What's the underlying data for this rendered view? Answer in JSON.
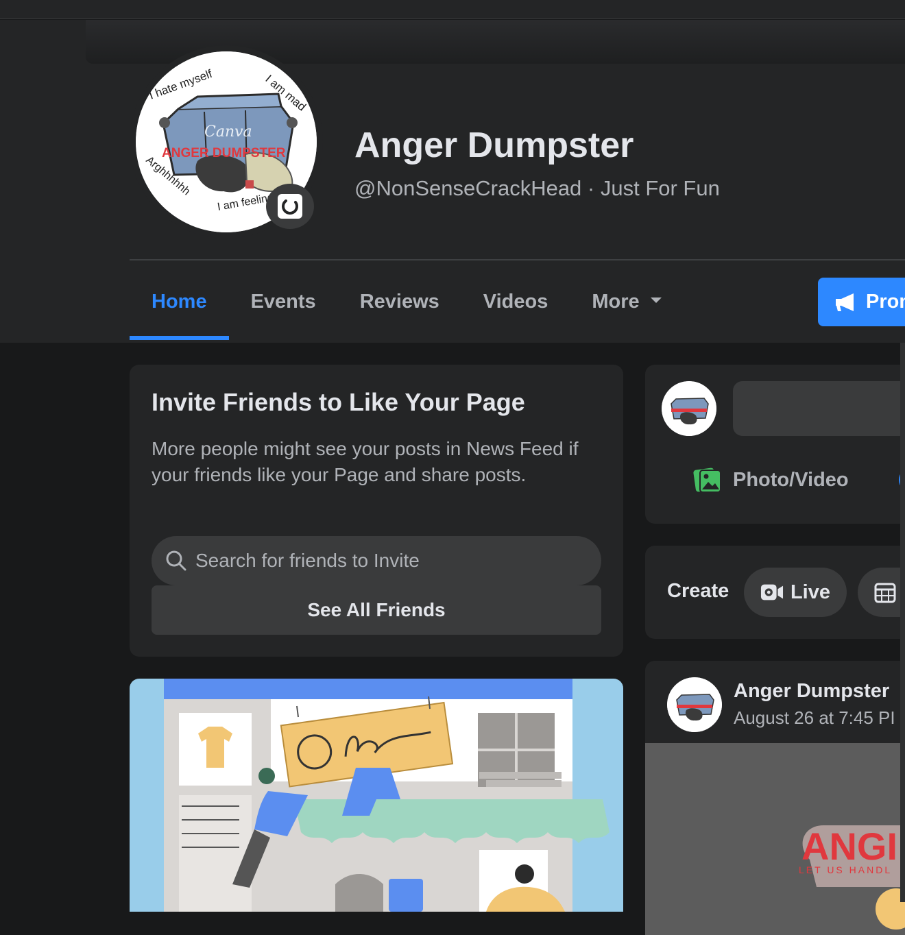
{
  "page": {
    "name": "Anger Dumpster",
    "handle_category": "@NonSenseCrackHead · Just For Fun"
  },
  "avatar_art": {
    "lines": [
      "I hate myself",
      "I am mad",
      "Arghhhhhh",
      "I am feeling sad"
    ],
    "canva_mark": "Canva",
    "banner": "ANGER DUMPSTER"
  },
  "tabs": [
    {
      "label": "Home",
      "active": true
    },
    {
      "label": "Events"
    },
    {
      "label": "Reviews"
    },
    {
      "label": "Videos"
    },
    {
      "label": "More"
    }
  ],
  "promote_label": "Pron",
  "invite": {
    "title": "Invite Friends to Like Your Page",
    "description": "More people might see your posts in News Feed if your friends like your Page and share posts.",
    "search_placeholder": "Search for friends to Invite",
    "see_all_label": "See All Friends"
  },
  "composer": {
    "photo_video_label": "Photo/Video"
  },
  "create": {
    "label": "Create",
    "live_label": "Live"
  },
  "post": {
    "author": "Anger Dumpster",
    "timestamp": "August 26 at 7:45 PI",
    "image_text": "ANGI",
    "image_subtext": "LET US HANDL"
  },
  "colors": {
    "accent": "#2d88ff",
    "background": "#18191a",
    "card": "#242526",
    "control": "#3a3b3c",
    "logo_red": "#e0383e",
    "photo_icon_green": "#45bd62"
  },
  "icons": [
    "loading-icon",
    "chevron-down-icon",
    "megaphone-icon",
    "search-icon",
    "photo-icon",
    "live-video-icon",
    "calendar-icon"
  ]
}
